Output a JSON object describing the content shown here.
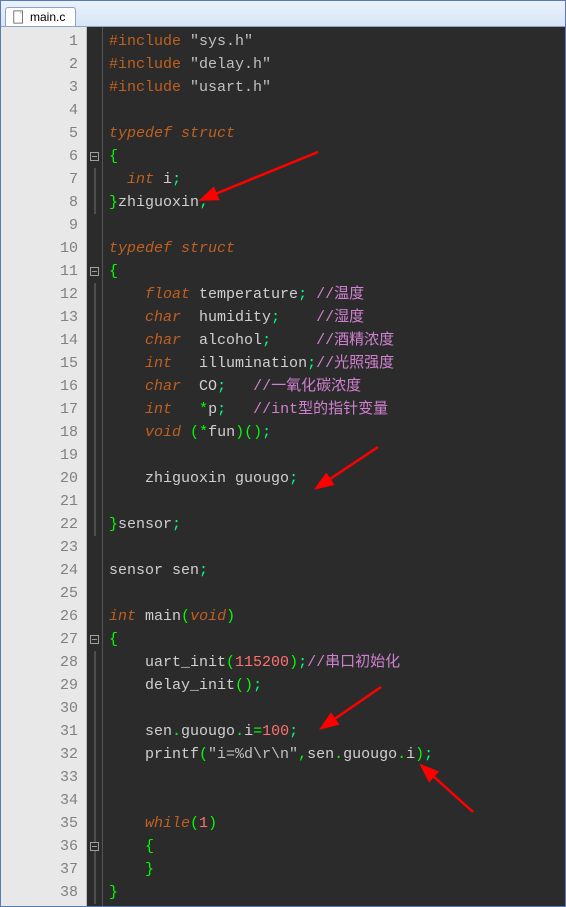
{
  "tab": {
    "filename": "main.c"
  },
  "lines": {
    "count": 38,
    "fold_markers": [
      6,
      11,
      27,
      36
    ],
    "fold_lines_start": [
      6,
      11,
      27,
      36
    ],
    "fold_lines_end": [
      8,
      22,
      38,
      37
    ]
  },
  "code": {
    "l1": {
      "pre": "#include",
      "str": "\"sys.h\""
    },
    "l2": {
      "pre": "#include",
      "str": "\"delay.h\""
    },
    "l3": {
      "pre": "#include",
      "str": "\"usart.h\""
    },
    "l5": {
      "kw": "typedef struct"
    },
    "l6": {
      "brace": "{"
    },
    "l7": {
      "type": "int",
      "name": "i",
      "semi": ";"
    },
    "l8": {
      "brace": "}",
      "name": "zhiguoxin",
      "semi": ";"
    },
    "l10": {
      "kw": "typedef struct"
    },
    "l11": {
      "brace": "{"
    },
    "l12": {
      "type": "float",
      "name": "temperature",
      "semi": ";",
      "comment": "//温度"
    },
    "l13": {
      "type": "char",
      "name": "humidity",
      "semi": ";",
      "comment": "//湿度"
    },
    "l14": {
      "type": "char",
      "name": "alcohol",
      "semi": ";",
      "comment": "//酒精浓度"
    },
    "l15": {
      "type": "int",
      "name": "illumination",
      "semi": ";",
      "comment": "//光照强度"
    },
    "l16": {
      "type": "char",
      "name": "CO",
      "semi": ";",
      "comment": "//一氧化碳浓度"
    },
    "l17": {
      "type": "int",
      "star": "*",
      "name": "p",
      "semi": ";",
      "comment": "//int型的指针变量"
    },
    "l18": {
      "type": "void",
      "lp": "(",
      "star": "*",
      "name": "fun",
      "rp": ")",
      "lp2": "(",
      "rp2": ")",
      "semi": ";"
    },
    "l20": {
      "type_name": "zhiguoxin",
      "name": "guougo",
      "semi": ";"
    },
    "l22": {
      "brace": "}",
      "name": "sensor",
      "semi": ";"
    },
    "l24": {
      "type_name": "sensor",
      "name": "sen",
      "semi": ";"
    },
    "l26": {
      "type": "int",
      "name": "main",
      "lp": "(",
      "arg": "void",
      "rp": ")"
    },
    "l27": {
      "brace": "{"
    },
    "l28": {
      "fn": "uart_init",
      "lp": "(",
      "num": "115200",
      "rp": ")",
      "semi": ";",
      "comment": "//串口初始化"
    },
    "l29": {
      "fn": "delay_init",
      "lp": "(",
      "rp": ")",
      "semi": ";"
    },
    "l31": {
      "a": "sen",
      "d1": ".",
      "b": "guougo",
      "d2": ".",
      "c": "i",
      "eq": "=",
      "num": "100",
      "semi": ";"
    },
    "l32": {
      "fn": "printf",
      "lp": "(",
      "str": "\"i=%d\\r\\n\"",
      "comma": ",",
      "a": "sen",
      "d1": ".",
      "b": "guougo",
      "d2": ".",
      "c": "i",
      "rp": ")",
      "semi": ";"
    },
    "l35": {
      "kw": "while",
      "lp": "(",
      "num": "1",
      "rp": ")"
    },
    "l36": {
      "brace": "{"
    },
    "l37": {
      "brace": "}"
    },
    "l38": {
      "brace": "}"
    }
  }
}
